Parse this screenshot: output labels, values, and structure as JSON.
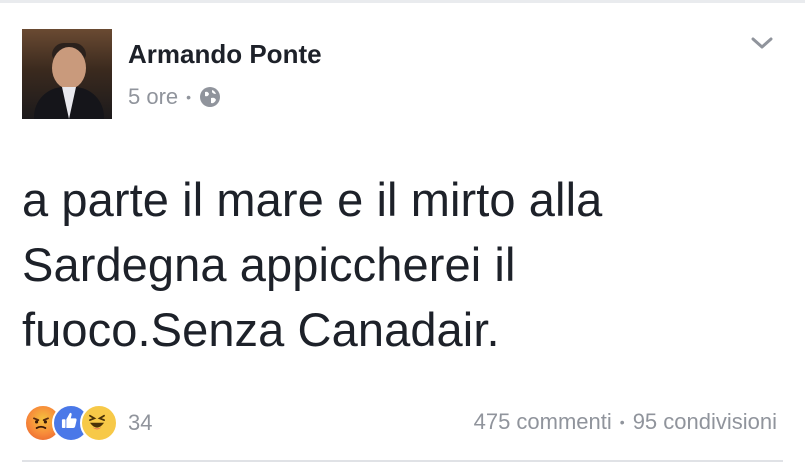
{
  "post": {
    "author": "Armando Ponte",
    "time": "5 ore",
    "separator": "•",
    "audience_icon": "globe-icon",
    "text": "a parte il mare e il mirto alla\nSardegna appiccherei il\nfuoco.Senza Canadair."
  },
  "reactions": {
    "icons": [
      "angry-reaction-icon",
      "like-reaction-icon",
      "haha-reaction-icon"
    ],
    "count": "34"
  },
  "stats": {
    "comments": "475 commenti",
    "separator": "•",
    "shares": "95 condivisioni"
  },
  "colors": {
    "text_primary": "#1d2129",
    "text_secondary": "#90949c",
    "like_blue": "#4a78e8"
  }
}
